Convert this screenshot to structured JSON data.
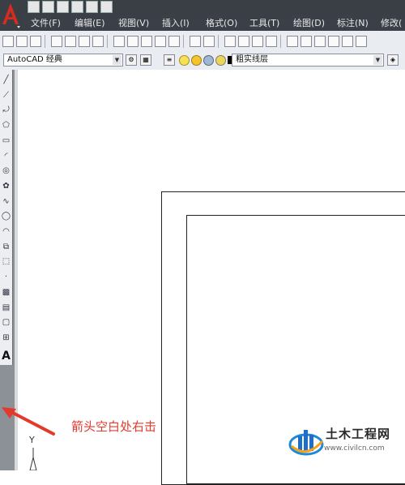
{
  "menu": {
    "items": [
      "文件(F)",
      "编辑(E)",
      "视图(V)",
      "插入(I)",
      "格式(O)",
      "工具(T)",
      "绘图(D)",
      "标注(N)",
      "修改("
    ]
  },
  "workspace": {
    "value": "AutoCAD 经典"
  },
  "layer": {
    "value": "粗实线层"
  },
  "left_toolbar": {
    "tools": [
      "line-icon",
      "construction-line-icon",
      "polyline-icon",
      "polygon-icon",
      "rectangle-icon",
      "arc-icon",
      "circle-icon",
      "revision-cloud-icon",
      "spline-icon",
      "ellipse-icon",
      "ellipse-arc-icon",
      "insert-block-icon",
      "make-block-icon",
      "point-icon",
      "hatch-icon",
      "gradient-icon",
      "region-icon",
      "table-icon"
    ],
    "text_tool": "A"
  },
  "ucs": {
    "y_label": "Y"
  },
  "annotation": {
    "text": "箭头空白处右击",
    "color": "#e33a2c"
  },
  "watermark": {
    "title": "土木工程网",
    "url": "www.civilcn.com"
  },
  "colors": {
    "title_bar": "#3a3f46",
    "toolbar": "#e9ecf0",
    "accent_red": "#d62b20"
  }
}
